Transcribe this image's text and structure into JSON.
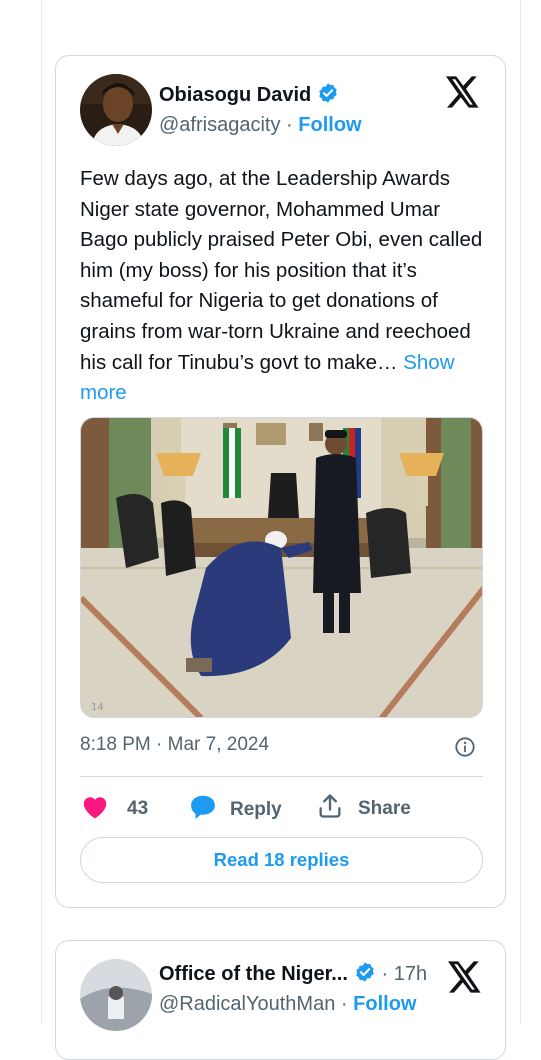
{
  "tweet": {
    "author_name": "Obiasogu David",
    "handle": "@afrisagacity",
    "separator": "·",
    "follow_label": "Follow",
    "text": "Few days ago, at the Leadership Awards Niger state governor, Mohammed Umar Bago  publicly praised Peter Obi, even called him (my boss) for his position that it’s shameful for Nigeria to get donations of grains from war-torn Ukraine and reechoed his call for Tinubu’s govt to make… ",
    "show_more_label": "Show more",
    "time": "8:18 PM",
    "date": "Mar 7, 2024",
    "likes_count": "43",
    "reply_label": "Reply",
    "share_label": "Share",
    "read_replies_label": "Read 18 replies"
  },
  "next_tweet": {
    "author_name": "Office of the Niger...",
    "separator": "·",
    "time_ago": "17h",
    "handle": "@RadicalYouthMan",
    "follow_label": "Follow"
  },
  "colors": {
    "accent": "#1d9bf0",
    "like": "#f91880",
    "text": "#0f1419",
    "secondary": "#536471",
    "border": "#cfd9de"
  },
  "icons": [
    "verified-badge-icon",
    "x-logo-icon",
    "info-icon",
    "heart-icon",
    "reply-bubble-icon",
    "share-icon"
  ]
}
